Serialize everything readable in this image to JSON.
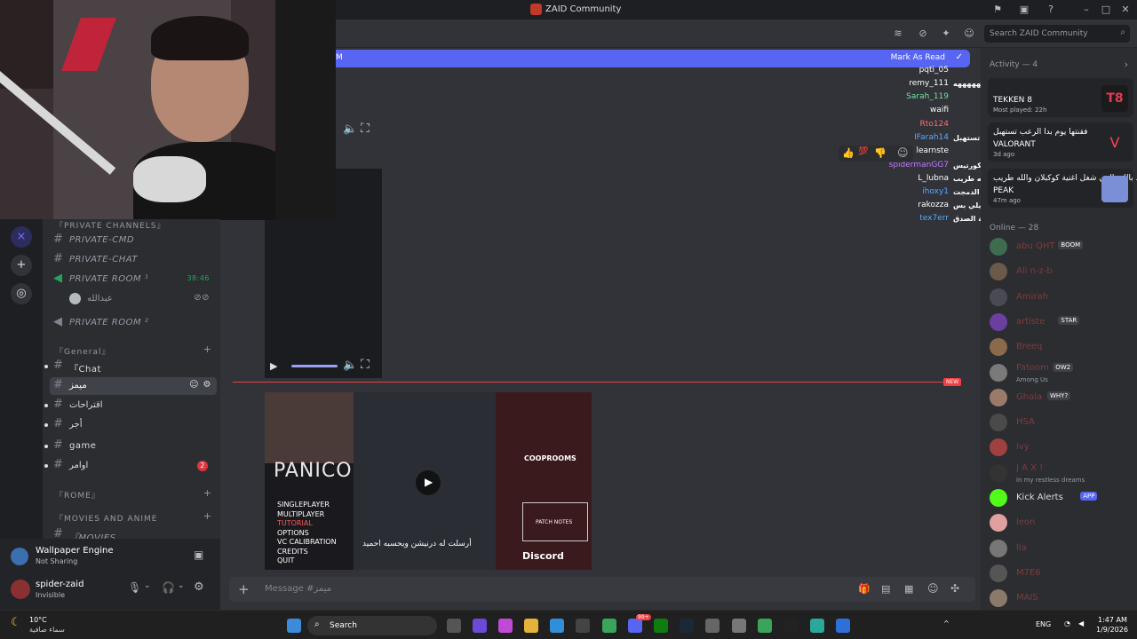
{
  "window": {
    "title": "ZAID Community"
  },
  "header": {
    "search_placeholder": "Search ZAID Community"
  },
  "banner": {
    "mark_as_read": "Mark As Read",
    "left_text": "M"
  },
  "channels": {
    "categories": [
      "『PRIVATE CHANNELS』",
      "『General』",
      "『ROME』",
      "『MOVIES AND ANIME"
    ],
    "private": [
      "PRIVATE-CMD",
      "PRIVATE-CHAT",
      "PRIVATE ROOM ¹",
      "PRIVATE ROOM ²"
    ],
    "voice_time": "38:46",
    "voice_user": "عبدالله",
    "general": [
      "『Chat",
      "ميمز",
      "اقتراحات",
      "أجر",
      "game",
      "اوامر"
    ],
    "badge": "2",
    "movies_channel": "『MOVIES"
  },
  "user_panel": {
    "app_name": "Wallpaper Engine",
    "app_status": "Not Sharing",
    "username": "spider-zaid",
    "user_status": "Invisible"
  },
  "chat": {
    "placeholder": "Message #ميمز"
  },
  "overlay_chat": [
    {
      "user": "pqti_05",
      "msg": "",
      "color": "#ffffff"
    },
    {
      "user": "remy_111",
      "msg": "ومع ذلك تتجيها ههههههه",
      "color": "#ffffff"
    },
    {
      "user": "Sarah_119",
      "msg": "",
      "color": "#7be0a0"
    },
    {
      "user": "waifi",
      "msg": "",
      "color": "#ffffff"
    },
    {
      "user": "Rto124",
      "msg": "",
      "color": "#ff6e6e"
    },
    {
      "user": "IFarah14",
      "msg": "فقنتها يوم بدا الرعب تستهبل",
      "color": "#5aa9ff"
    },
    {
      "user": "learnste",
      "msg": "",
      "color": "#ffffff"
    },
    {
      "user": "spidermanGG7",
      "msg": "افتح كورتيس",
      "color": "#c07bff"
    },
    {
      "user": "L_lubna",
      "msg": "زيد بالله بالغي شغل اغنية كوكبلان والله طريب",
      "color": "#ffffff"
    },
    {
      "user": "ihoxy1",
      "msg": "كمل الدمجت",
      "color": "#5aa9ff"
    },
    {
      "user": "rakozza",
      "msg": "وتك موبايلي بس",
      "color": "#ffffff"
    },
    {
      "user": "tex7err",
      "msg": "اغانيك كرنجية الصدق",
      "color": "#5aa9ff"
    }
  ],
  "embed": {
    "game_title": "PANICO",
    "menu": [
      "SINGLEPLAYER",
      "MULTIPLAYER",
      "TUTORIAL",
      "OPTIONS",
      "VC CALIBRATION",
      "CREDITS",
      "QUIT"
    ],
    "coop": "COOPROOMS",
    "patch": "PATCH NOTES",
    "discord": "Discord",
    "caption": "أرسلت له درنيشن ويحسبه احميد",
    "new_badge": "NEW"
  },
  "members": {
    "activity_header": "Activity — 4",
    "activities": [
      {
        "t1": "",
        "t2": "TEKKEN 8",
        "t3": "Most played: 22h"
      },
      {
        "t1": "فقنتها يوم بدا الرعب تستهبل",
        "t2": "VALORANT",
        "t3": "3d ago"
      },
      {
        "t1": "زيد بالله بالغي شغل اغنية كوكبلان والله طريب",
        "t2": "PEAK",
        "t3": "47m ago"
      }
    ],
    "online_header": "Online — 28",
    "list": [
      {
        "name": "abu QHT",
        "tag": "BOOM",
        "sub": ""
      },
      {
        "name": "Ali n-z-b",
        "tag": "",
        "sub": ""
      },
      {
        "name": "Amirah",
        "tag": "",
        "sub": ""
      },
      {
        "name": "artiste",
        "tag": "STAR",
        "sub": ""
      },
      {
        "name": "Breeq",
        "tag": "",
        "sub": ""
      },
      {
        "name": "Fatoom",
        "tag": "OW2",
        "sub": "Among Us"
      },
      {
        "name": "Ghala",
        "tag": "WHY?",
        "sub": ""
      },
      {
        "name": "HSA",
        "tag": "",
        "sub": ""
      },
      {
        "name": "ivy",
        "tag": "",
        "sub": ""
      },
      {
        "name": "J A X !",
        "tag": "",
        "sub": "in my restless dreams"
      },
      {
        "name": "Kick Alerts",
        "tag": "APP",
        "sub": ""
      },
      {
        "name": "leon",
        "tag": "",
        "sub": ""
      },
      {
        "name": "lla",
        "tag": "",
        "sub": ""
      },
      {
        "name": "M7E6",
        "tag": "",
        "sub": ""
      },
      {
        "name": "MAIS",
        "tag": "",
        "sub": ""
      }
    ]
  },
  "taskbar": {
    "weather_temp": "10°C",
    "weather_desc": "سماء صافية",
    "search": "Search",
    "lang": "ENG",
    "time": "1:47 AM",
    "date": "1/9/2026",
    "discord_badge": "99+"
  }
}
